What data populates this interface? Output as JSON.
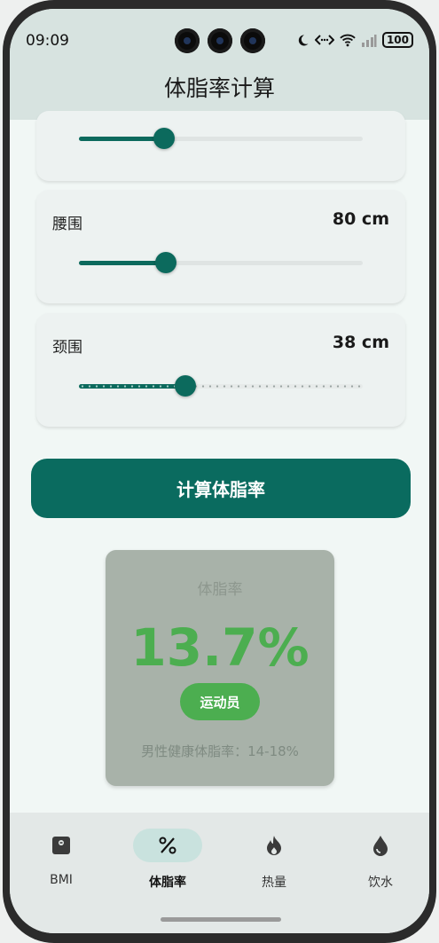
{
  "status_bar": {
    "time": "09:09",
    "battery": "100",
    "icons": [
      "moon-icon",
      "link-icon",
      "wifi-icon",
      "signal-icon",
      "battery-icon"
    ]
  },
  "header": {
    "title": "体脂率计算"
  },
  "sliders": [
    {
      "label": "",
      "value_text": "",
      "fraction": 0.3
    },
    {
      "label": "腰围",
      "value_text": "80 cm",
      "fraction": 0.3
    },
    {
      "label": "颈围",
      "value_text": "38 cm",
      "fraction": 0.37
    }
  ],
  "calculate_button": {
    "label": "计算体脂率"
  },
  "result": {
    "label": "体脂率",
    "value": "13.7%",
    "category": "运动员",
    "range_text": "男性健康体脂率：14-18%"
  },
  "colors": {
    "primary": "#0a6b5f",
    "result_green": "#4cae50",
    "header_bg": "#d7e3e0",
    "page_bg": "#f1f7f5"
  },
  "bottom_nav": {
    "items": [
      {
        "label": "BMI",
        "icon": "scale-icon",
        "active": false
      },
      {
        "label": "体脂率",
        "icon": "percent-icon",
        "active": true
      },
      {
        "label": "热量",
        "icon": "flame-icon",
        "active": false
      },
      {
        "label": "饮水",
        "icon": "water-drop-icon",
        "active": false
      }
    ]
  }
}
